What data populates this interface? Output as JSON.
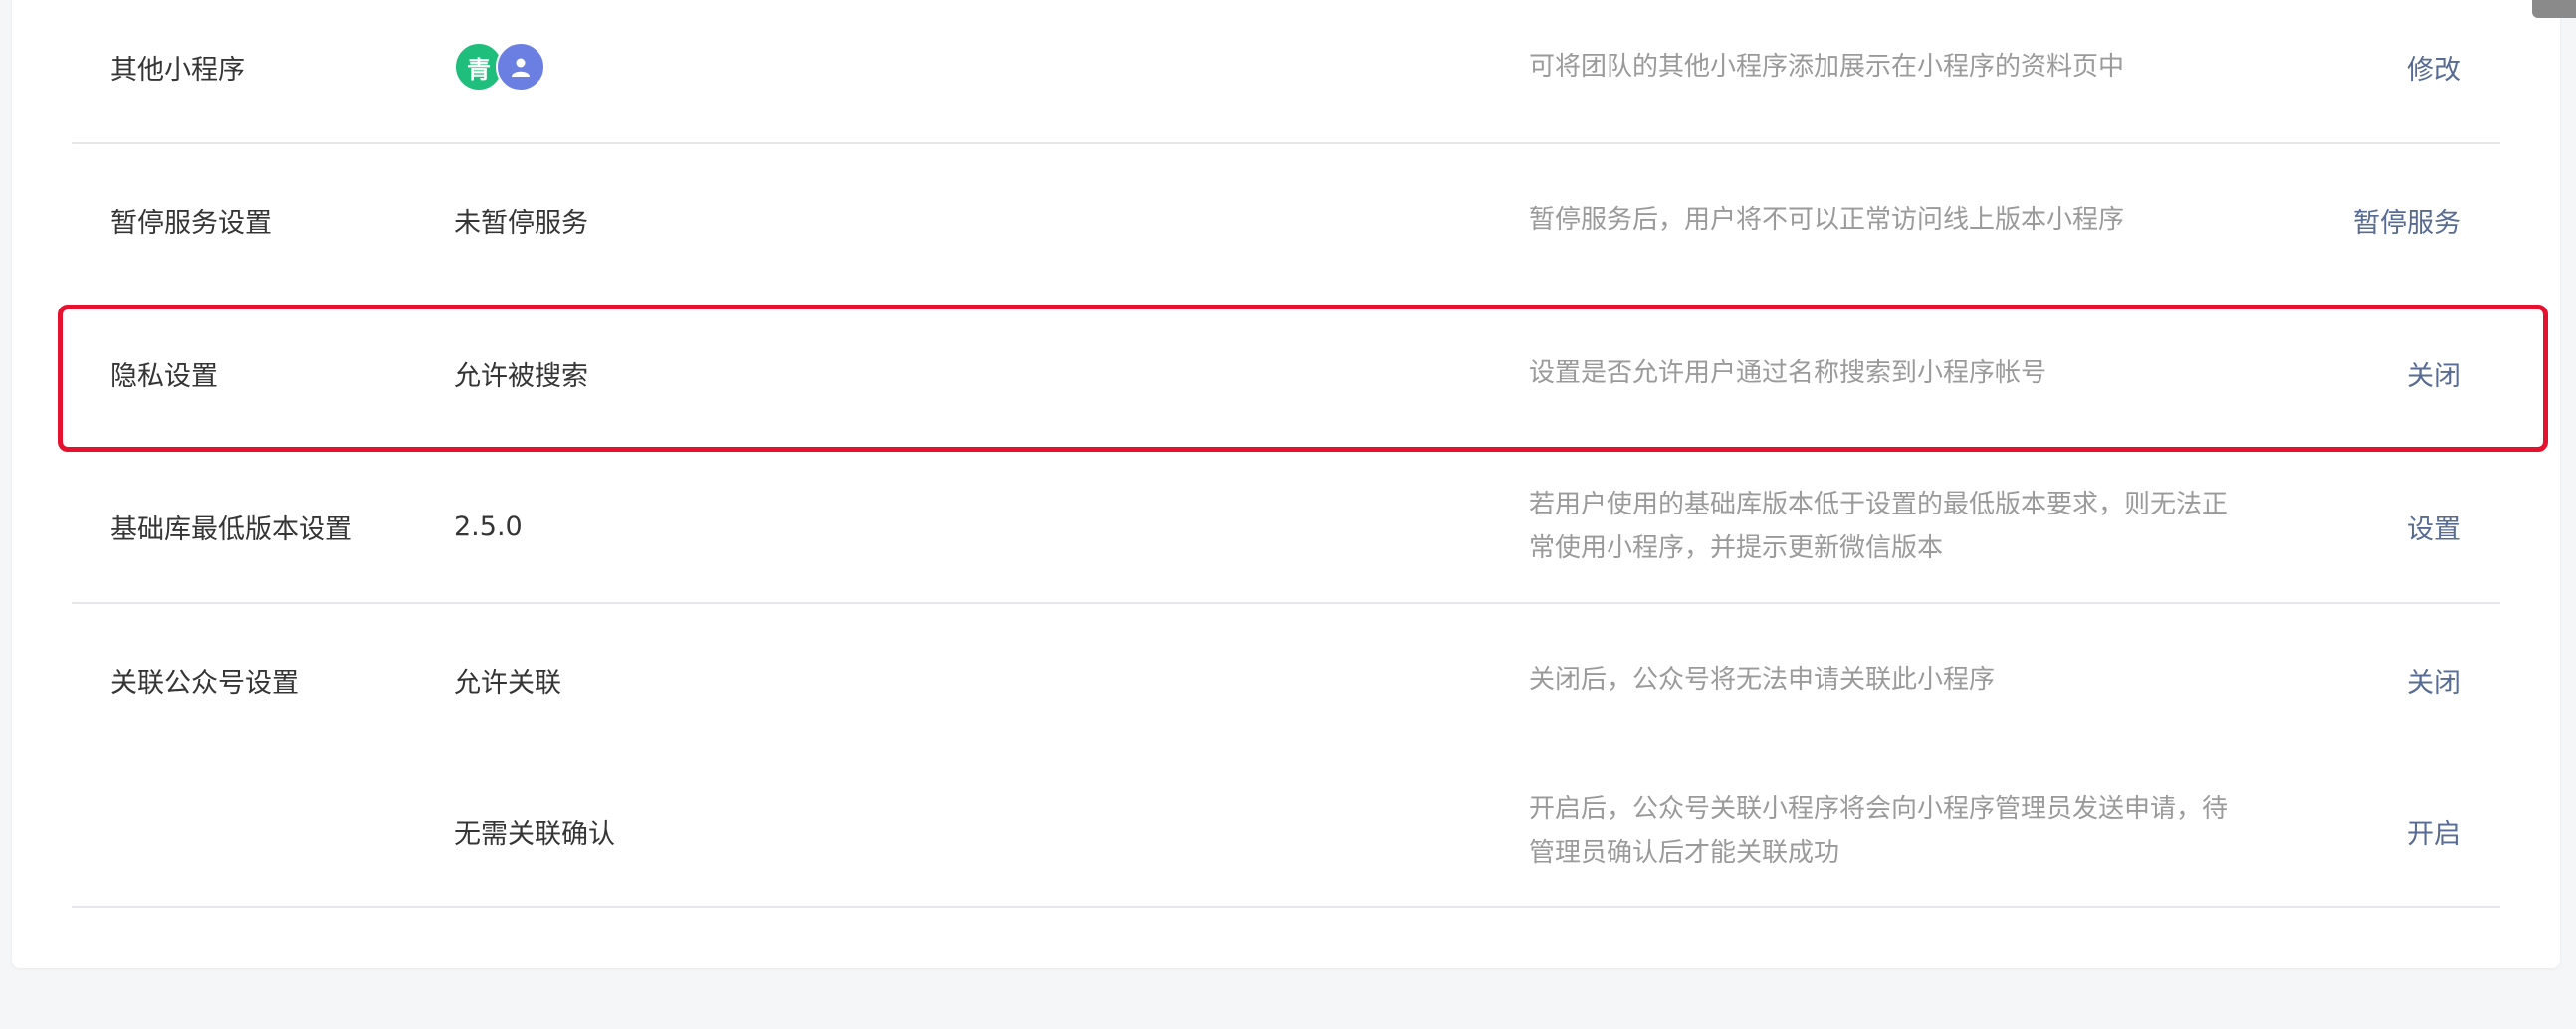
{
  "rows": [
    {
      "label": "其他小程序",
      "value": "",
      "desc": "可将团队的其他小程序添加展示在小程序的资料页中",
      "action": "修改"
    },
    {
      "label": "暂停服务设置",
      "value": "未暂停服务",
      "desc": "暂停服务后，用户将不可以正常访问线上版本小程序",
      "action": "暂停服务"
    },
    {
      "label": "隐私设置",
      "value": "允许被搜索",
      "desc": "设置是否允许用户通过名称搜索到小程序帐号",
      "action": "关闭"
    },
    {
      "label": "基础库最低版本设置",
      "value": "2.5.0",
      "desc": "若用户使用的基础库版本低于设置的最低版本要求，则无法正常使用小程序，并提示更新微信版本",
      "action": "设置"
    },
    {
      "label": "关联公众号设置",
      "value": "允许关联",
      "desc": "关闭后，公众号将无法申请关联此小程序",
      "action": "关闭"
    },
    {
      "label": "",
      "value": "无需关联确认",
      "desc": "开启后，公众号关联小程序将会向小程序管理员发送申请，待管理员确认后才能关联成功",
      "action": "开启"
    }
  ],
  "mini_program_avatars": [
    {
      "glyph": "青",
      "color": "#1fbe7c",
      "icon": "qing-app-icon"
    },
    {
      "glyph": "⚇",
      "color": "#6b7fe3",
      "icon": "user-app-icon"
    }
  ],
  "colors": {
    "link": "#576b95",
    "highlight_border": "#e5112f"
  }
}
